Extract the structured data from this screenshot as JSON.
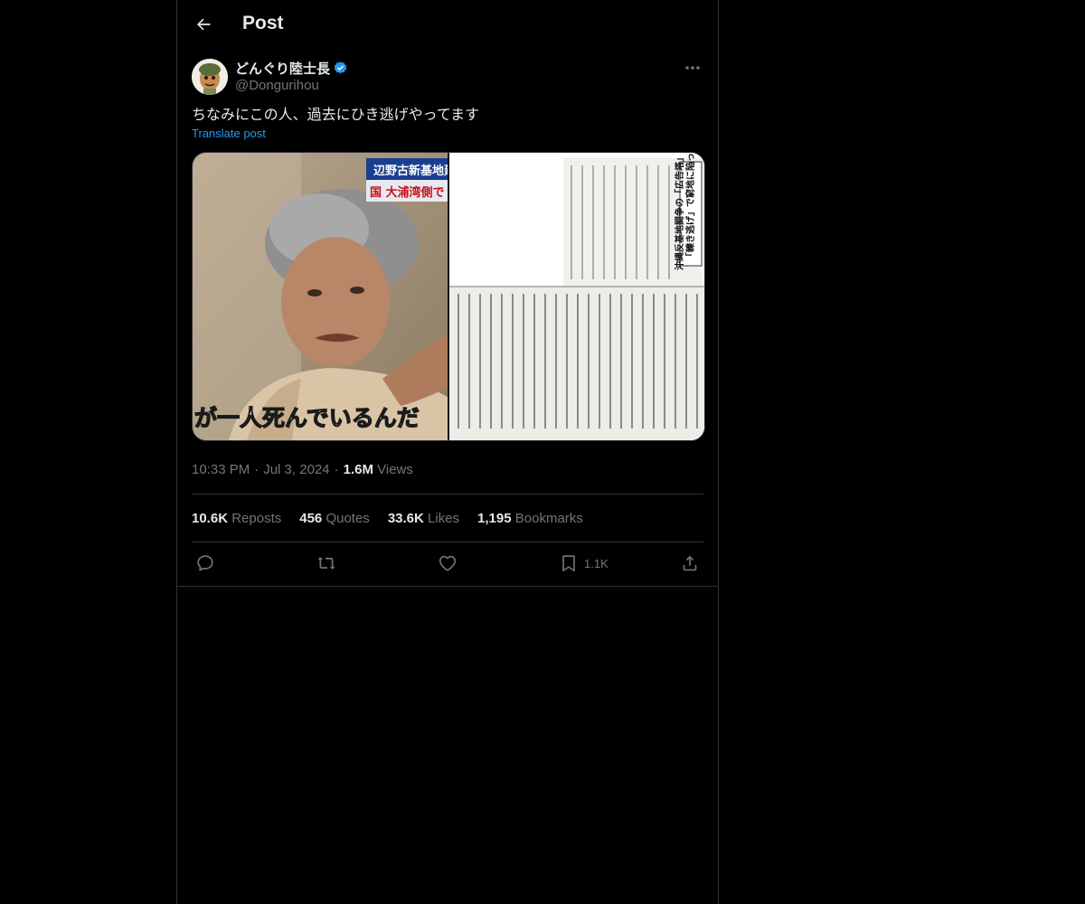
{
  "header": {
    "title": "Post"
  },
  "author": {
    "display_name": "どんぐり陸士長",
    "handle": "@Dongurihou"
  },
  "tweet": {
    "text": "ちなみにこの人、過去にひき逃げやってます",
    "translate_label": "Translate post"
  },
  "media": {
    "left_caption": "が一人死んでいるんだ",
    "left_top_banner": "辺野古新基地建",
    "left_top_banner_2": "国 大浦湾側で",
    "newspaper_headline_1": "「轢き逃げ」で窮地に陥った",
    "newspaper_headline_2": "沖縄反基地闘争の「広告塔」"
  },
  "meta": {
    "time": "10:33 PM",
    "date": "Jul 3, 2024",
    "views_count": "1.6M",
    "views_label": "Views",
    "separator": "·"
  },
  "stats": [
    {
      "count": "10.6K",
      "label": "Reposts"
    },
    {
      "count": "456",
      "label": "Quotes"
    },
    {
      "count": "33.6K",
      "label": "Likes"
    },
    {
      "count": "1,195",
      "label": "Bookmarks"
    }
  ],
  "actions": {
    "bookmark_count": "1.1K"
  },
  "colors": {
    "background": "#000000",
    "text": "#e7e9ea",
    "muted": "#71767b",
    "accent": "#1d9bf0",
    "border": "#2f3336"
  },
  "icons": [
    "back-arrow-icon",
    "verified-badge-icon",
    "more-icon",
    "reply-icon",
    "repost-icon",
    "like-icon",
    "bookmark-icon",
    "share-icon"
  ]
}
